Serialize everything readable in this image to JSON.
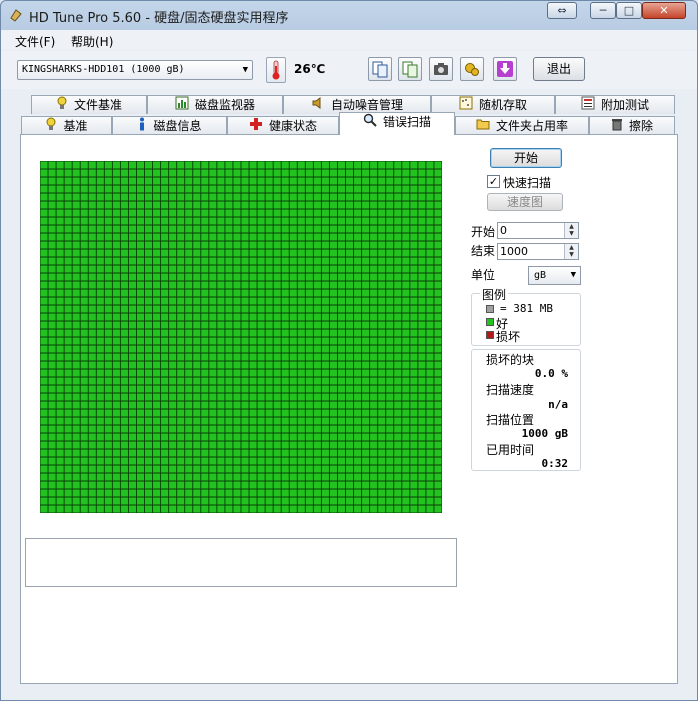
{
  "window": {
    "title": "HD Tune Pro 5.60 - 硬盘/固态硬盘实用程序",
    "controls": [
      "⇔",
      "─",
      "□",
      "✕"
    ]
  },
  "menu": [
    "文件(F)",
    "帮助(H)"
  ],
  "toolbar": {
    "drive": "KINGSHARKS-HDD101  (1000 gB)",
    "temperature": "26℃",
    "exit_label": "退出",
    "icons": [
      "copy-info-icon",
      "copy-screen-icon",
      "camera-icon",
      "settings-icon",
      "download-icon"
    ]
  },
  "tabs": {
    "row_top": [
      "文件基准",
      "磁盘监视器",
      "自动噪音管理",
      "随机存取",
      "附加测试"
    ],
    "row_bottom": [
      "基准",
      "磁盘信息",
      "健康状态",
      "错误扫描",
      "文件夹占用率",
      "擦除"
    ],
    "active": "错误扫描"
  },
  "scan": {
    "start_label": "开始",
    "quick_scan_label": "快速扫描",
    "quick_scan_checked": true,
    "speed_map_label": "速度图",
    "start_field_label": "开始",
    "start_value": "0",
    "end_field_label": "结束",
    "end_value": "1000",
    "unit_label": "单位",
    "unit_value": "gB",
    "block_status": "good",
    "good_color": "#22c21f",
    "bad_color": "#b21a1a"
  },
  "legend": {
    "title": "图例",
    "block_size": "= 381 MB",
    "good_label": "好",
    "bad_label": "损坏"
  },
  "stats": {
    "damaged_label": "损坏的块",
    "damaged_value": "0.0 %",
    "speed_label": "扫描速度",
    "speed_value": "n/a",
    "position_label": "扫描位置",
    "position_value": "1000 gB",
    "elapsed_label": "已用时间",
    "elapsed_value": "0:32"
  }
}
